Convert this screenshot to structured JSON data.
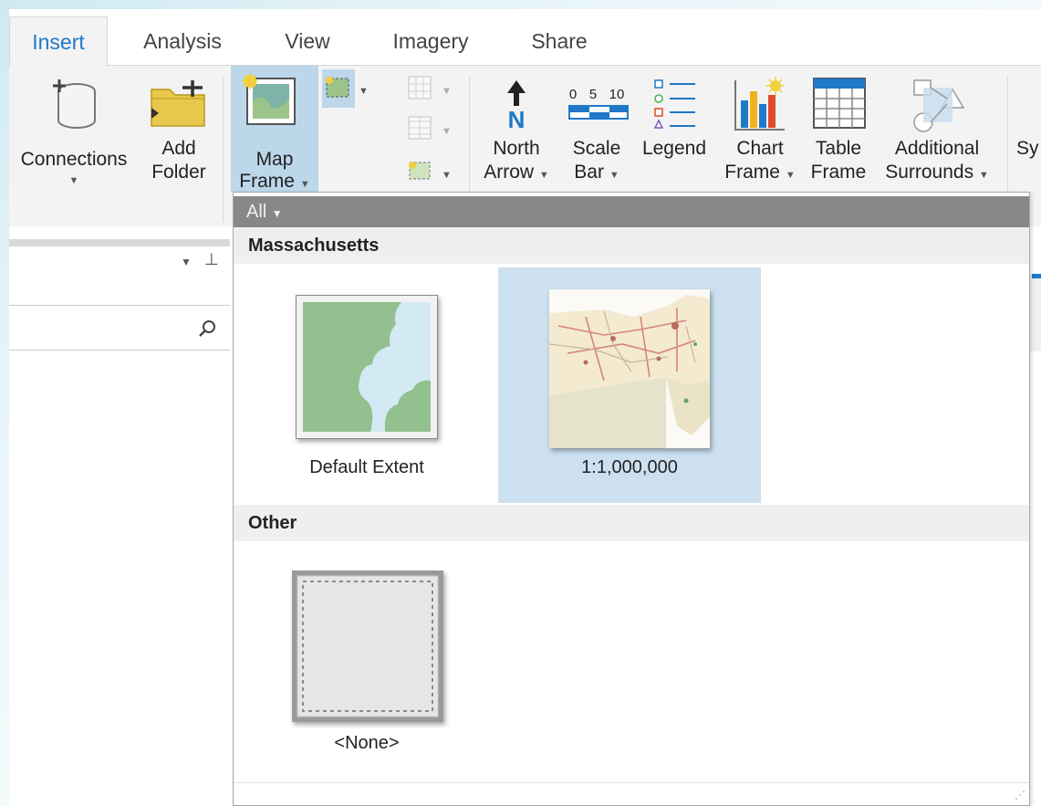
{
  "tabs": [
    "Insert",
    "Analysis",
    "View",
    "Imagery",
    "Share"
  ],
  "ribbon": {
    "connections": "Connections",
    "add_folder": [
      "Add",
      "Folder"
    ],
    "map_frame": [
      "Map",
      "Frame"
    ],
    "north_arrow": [
      "North",
      "Arrow"
    ],
    "scale_bar": [
      "Scale",
      "Bar"
    ],
    "scale_bar_ticks": [
      "0",
      "5",
      "10"
    ],
    "north_letter": "N",
    "legend": "Legend",
    "chart_frame": [
      "Chart",
      "Frame"
    ],
    "table_frame": [
      "Table",
      "Frame"
    ],
    "additional_surrounds": [
      "Additional",
      "Surrounds"
    ],
    "cut_off": "Sy"
  },
  "gallery": {
    "filter": "All",
    "sections": [
      {
        "title": "Massachusetts",
        "items": [
          {
            "label": "Default Extent",
            "selected": false
          },
          {
            "label": "1:1,000,000",
            "selected": true
          }
        ]
      },
      {
        "title": "Other",
        "items": [
          {
            "label": "<None>",
            "selected": false
          }
        ]
      }
    ]
  },
  "colors": {
    "accent": "#1f78c8",
    "selection": "#cde0f0",
    "header_gray": "#888888"
  }
}
